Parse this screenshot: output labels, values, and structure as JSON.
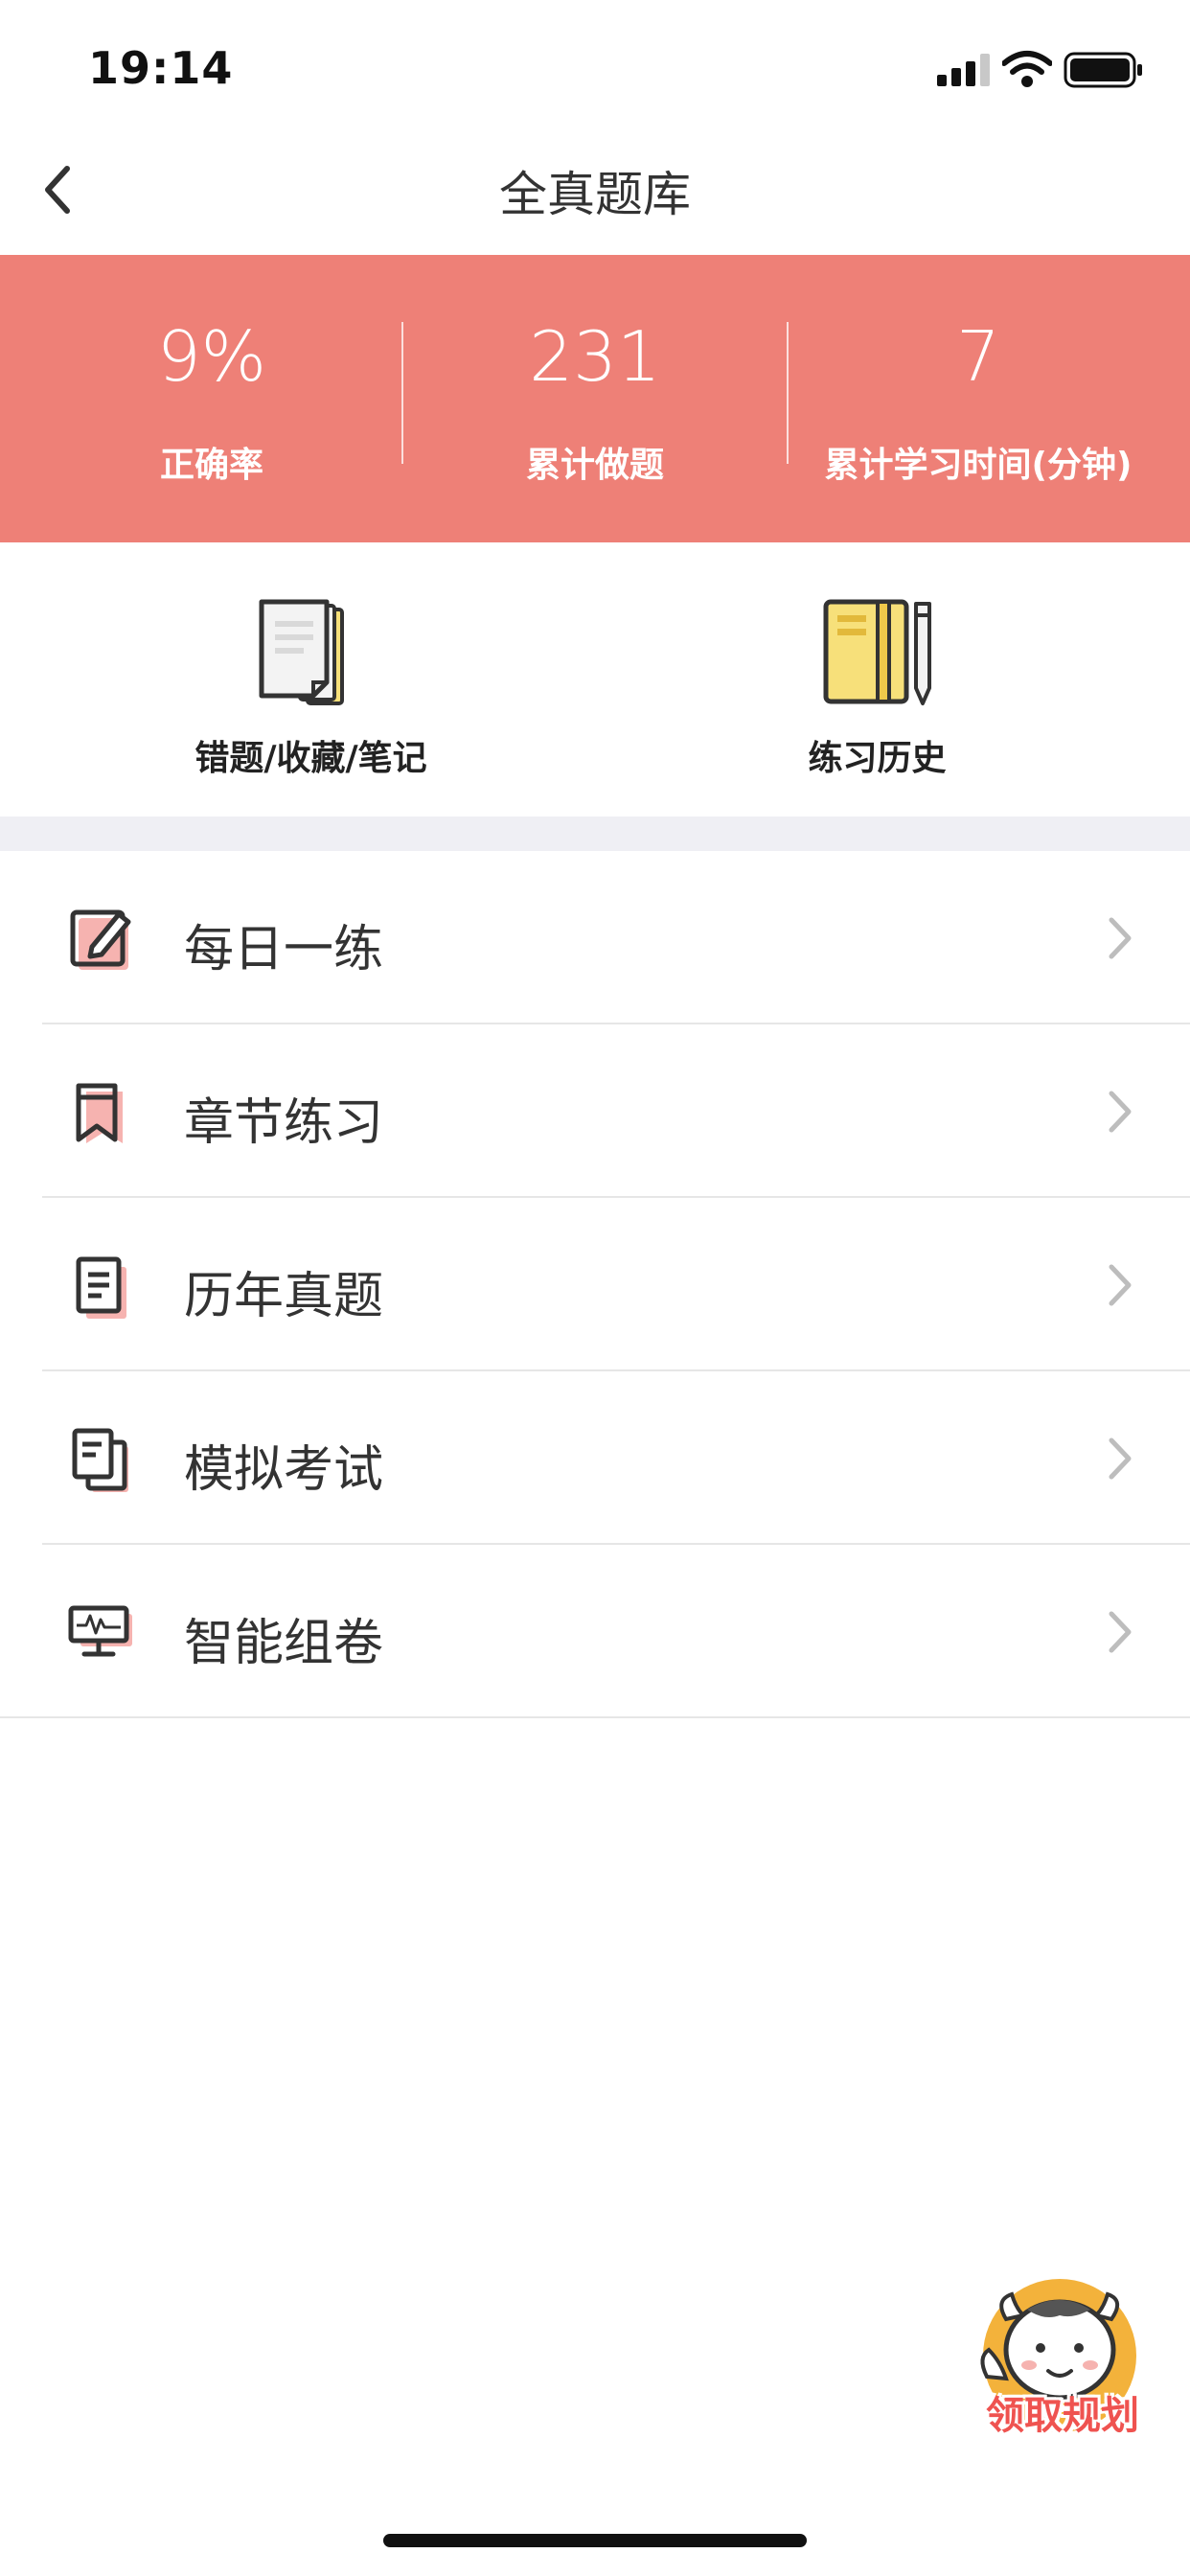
{
  "status_bar": {
    "time": "19:14"
  },
  "header": {
    "title": "全真题库"
  },
  "stats": [
    {
      "value": "9%",
      "label": "正确率"
    },
    {
      "value": "231",
      "label": "累计做题"
    },
    {
      "value": "7",
      "label": "累计学习时间(分钟)"
    }
  ],
  "quick_actions": [
    {
      "label": "错题/收藏/笔记",
      "icon": "documents-icon"
    },
    {
      "label": "练习历史",
      "icon": "notebook-pencil-icon"
    }
  ],
  "menu": [
    {
      "label": "每日一练",
      "icon": "edit-icon"
    },
    {
      "label": "章节练习",
      "icon": "bookmark-icon"
    },
    {
      "label": "历年真题",
      "icon": "document-icon"
    },
    {
      "label": "模拟考试",
      "icon": "exam-copy-icon"
    },
    {
      "label": "智能组卷",
      "icon": "monitor-icon"
    }
  ],
  "floating": {
    "label": "领取规划",
    "icon": "cow-mascot-icon"
  },
  "colors": {
    "accent": "#ee8077",
    "divider_bg": "#efeff4",
    "icon_accent": "#f6b3b0",
    "yellow": "#f7e07a"
  }
}
